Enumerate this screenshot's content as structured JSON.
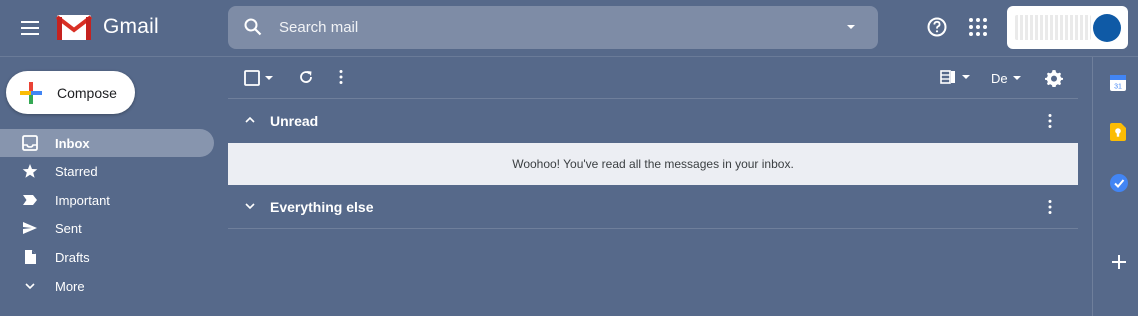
{
  "app": {
    "name": "Gmail"
  },
  "search": {
    "placeholder": "Search mail"
  },
  "compose": {
    "label": "Compose"
  },
  "sidebar": {
    "items": [
      {
        "label": "Inbox",
        "icon": "inbox-icon",
        "active": true
      },
      {
        "label": "Starred",
        "icon": "star-icon",
        "active": false
      },
      {
        "label": "Important",
        "icon": "important-icon",
        "active": false
      },
      {
        "label": "Sent",
        "icon": "send-icon",
        "active": false
      },
      {
        "label": "Drafts",
        "icon": "draft-icon",
        "active": false
      },
      {
        "label": "More",
        "icon": "chevron-down-icon",
        "active": false
      }
    ]
  },
  "sections": [
    {
      "title": "Unread",
      "expanded": true,
      "empty_message": "Woohoo! You've read all the messages in your inbox."
    },
    {
      "title": "Everything else",
      "expanded": false
    }
  ],
  "colors": {
    "background": "#56698a",
    "active_nav": "#8795ae",
    "search_bg": "#7e8ca6",
    "empty_row_bg": "#eceef3",
    "avatar": "#0f5aa6"
  },
  "side_panel": {
    "icons": [
      "calendar-icon",
      "keep-icon",
      "tasks-icon",
      "add-icon"
    ],
    "calendar_day": "31"
  }
}
